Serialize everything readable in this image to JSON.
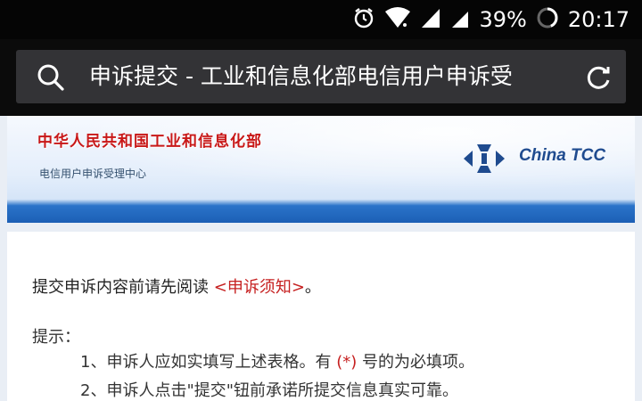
{
  "status_bar": {
    "battery_percent": "39%",
    "time": "20:17",
    "icons": [
      "alarm-icon",
      "wifi-icon",
      "signal-icon",
      "signal-icon",
      "battery-icon"
    ]
  },
  "browser": {
    "url_text": "申诉提交 - 工业和信息化部电信用户申诉受",
    "icons": [
      "search-icon",
      "reload-icon"
    ]
  },
  "banner": {
    "title": "中华人民共和国工业和信息化部",
    "subtitle": "电信用户申诉受理中心",
    "logo_text": "China TCC"
  },
  "content": {
    "notice_prefix": "提交申诉内容前请先阅读 ",
    "notice_link": "<申诉须知>",
    "notice_suffix": "。",
    "tips_label": "提示：",
    "tip1_a": "1、申诉人应如实填写上述表格。有 ",
    "tip1_req": "(*)",
    "tip1_b": " 号的为必填项。",
    "tip2": "2、申诉人点击\"提交\"钮前承诺所提交信息真实可靠。"
  },
  "colors": {
    "accent_red": "#c62020",
    "banner_blue": "#1c5fb5",
    "urlbar_bg": "#333336"
  }
}
